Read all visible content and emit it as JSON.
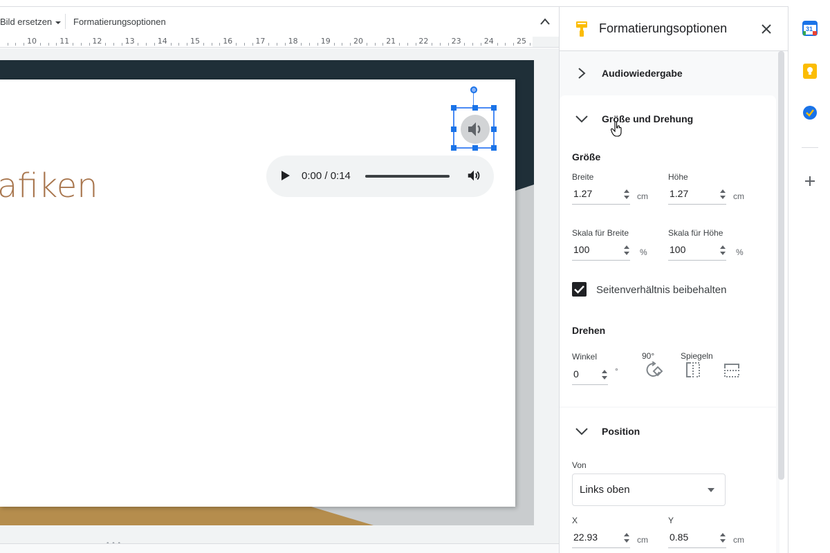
{
  "toolbar": {
    "replace_image_label": "Bild ersetzen",
    "format_options_label": "Formatierungsoptionen"
  },
  "ruler": {
    "numbers": [
      "10",
      "11",
      "12",
      "13",
      "14",
      "15",
      "16",
      "17",
      "18",
      "19",
      "20",
      "21",
      "22",
      "23",
      "24",
      "25"
    ]
  },
  "slide": {
    "title_fragment": "afiken",
    "audio_player": {
      "time": "0:00 / 0:14"
    }
  },
  "panel": {
    "title": "Formatierungsoptionen",
    "sections": {
      "audio": {
        "title": "Audiowiedergabe",
        "expanded": false
      },
      "size_rotation": {
        "title": "Größe und Drehung",
        "expanded": true,
        "size_heading": "Größe",
        "width_label": "Breite",
        "width_value": "1.27",
        "height_label": "Höhe",
        "height_value": "1.27",
        "unit_cm": "cm",
        "scale_width_label": "Skala für Breite",
        "scale_width_value": "100",
        "scale_height_label": "Skala für Höhe",
        "scale_height_value": "100",
        "unit_percent": "%",
        "aspect_label": "Seitenverhältnis beibehalten",
        "aspect_checked": true,
        "rotate_heading": "Drehen",
        "angle_label": "Winkel",
        "angle_value": "0",
        "degree_symbol": "°",
        "rotate90_label": "90°",
        "mirror_label": "Spiegeln"
      },
      "position": {
        "title": "Position",
        "expanded": true,
        "from_label": "Von",
        "from_value": "Links oben",
        "x_label": "X",
        "x_value": "22.93",
        "y_label": "Y",
        "y_value": "0.85",
        "unit_cm": "cm"
      }
    }
  },
  "colors": {
    "accent": "#1a73e8",
    "slide_title": "#a9774f",
    "slide_dark": "#1f2f38",
    "slide_gold": "#b58d4d"
  },
  "rail": {
    "icons": [
      "calendar-icon",
      "keep-icon",
      "tasks-icon",
      "add-icon"
    ],
    "calendar_day": "31"
  }
}
